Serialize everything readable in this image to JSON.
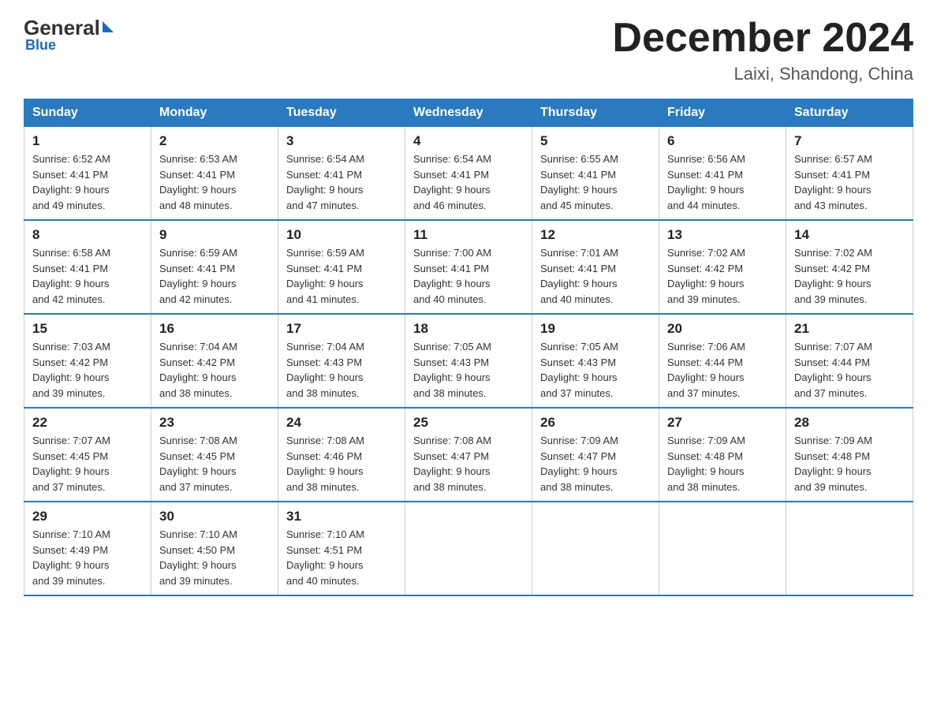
{
  "header": {
    "logo": {
      "general": "General",
      "blue": "Blue"
    },
    "title": "December 2024",
    "subtitle": "Laixi, Shandong, China"
  },
  "weekdays": [
    "Sunday",
    "Monday",
    "Tuesday",
    "Wednesday",
    "Thursday",
    "Friday",
    "Saturday"
  ],
  "weeks": [
    [
      {
        "day": "1",
        "sunrise": "Sunrise: 6:52 AM",
        "sunset": "Sunset: 4:41 PM",
        "daylight": "Daylight: 9 hours",
        "daylight2": "and 49 minutes."
      },
      {
        "day": "2",
        "sunrise": "Sunrise: 6:53 AM",
        "sunset": "Sunset: 4:41 PM",
        "daylight": "Daylight: 9 hours",
        "daylight2": "and 48 minutes."
      },
      {
        "day": "3",
        "sunrise": "Sunrise: 6:54 AM",
        "sunset": "Sunset: 4:41 PM",
        "daylight": "Daylight: 9 hours",
        "daylight2": "and 47 minutes."
      },
      {
        "day": "4",
        "sunrise": "Sunrise: 6:54 AM",
        "sunset": "Sunset: 4:41 PM",
        "daylight": "Daylight: 9 hours",
        "daylight2": "and 46 minutes."
      },
      {
        "day": "5",
        "sunrise": "Sunrise: 6:55 AM",
        "sunset": "Sunset: 4:41 PM",
        "daylight": "Daylight: 9 hours",
        "daylight2": "and 45 minutes."
      },
      {
        "day": "6",
        "sunrise": "Sunrise: 6:56 AM",
        "sunset": "Sunset: 4:41 PM",
        "daylight": "Daylight: 9 hours",
        "daylight2": "and 44 minutes."
      },
      {
        "day": "7",
        "sunrise": "Sunrise: 6:57 AM",
        "sunset": "Sunset: 4:41 PM",
        "daylight": "Daylight: 9 hours",
        "daylight2": "and 43 minutes."
      }
    ],
    [
      {
        "day": "8",
        "sunrise": "Sunrise: 6:58 AM",
        "sunset": "Sunset: 4:41 PM",
        "daylight": "Daylight: 9 hours",
        "daylight2": "and 42 minutes."
      },
      {
        "day": "9",
        "sunrise": "Sunrise: 6:59 AM",
        "sunset": "Sunset: 4:41 PM",
        "daylight": "Daylight: 9 hours",
        "daylight2": "and 42 minutes."
      },
      {
        "day": "10",
        "sunrise": "Sunrise: 6:59 AM",
        "sunset": "Sunset: 4:41 PM",
        "daylight": "Daylight: 9 hours",
        "daylight2": "and 41 minutes."
      },
      {
        "day": "11",
        "sunrise": "Sunrise: 7:00 AM",
        "sunset": "Sunset: 4:41 PM",
        "daylight": "Daylight: 9 hours",
        "daylight2": "and 40 minutes."
      },
      {
        "day": "12",
        "sunrise": "Sunrise: 7:01 AM",
        "sunset": "Sunset: 4:41 PM",
        "daylight": "Daylight: 9 hours",
        "daylight2": "and 40 minutes."
      },
      {
        "day": "13",
        "sunrise": "Sunrise: 7:02 AM",
        "sunset": "Sunset: 4:42 PM",
        "daylight": "Daylight: 9 hours",
        "daylight2": "and 39 minutes."
      },
      {
        "day": "14",
        "sunrise": "Sunrise: 7:02 AM",
        "sunset": "Sunset: 4:42 PM",
        "daylight": "Daylight: 9 hours",
        "daylight2": "and 39 minutes."
      }
    ],
    [
      {
        "day": "15",
        "sunrise": "Sunrise: 7:03 AM",
        "sunset": "Sunset: 4:42 PM",
        "daylight": "Daylight: 9 hours",
        "daylight2": "and 39 minutes."
      },
      {
        "day": "16",
        "sunrise": "Sunrise: 7:04 AM",
        "sunset": "Sunset: 4:42 PM",
        "daylight": "Daylight: 9 hours",
        "daylight2": "and 38 minutes."
      },
      {
        "day": "17",
        "sunrise": "Sunrise: 7:04 AM",
        "sunset": "Sunset: 4:43 PM",
        "daylight": "Daylight: 9 hours",
        "daylight2": "and 38 minutes."
      },
      {
        "day": "18",
        "sunrise": "Sunrise: 7:05 AM",
        "sunset": "Sunset: 4:43 PM",
        "daylight": "Daylight: 9 hours",
        "daylight2": "and 38 minutes."
      },
      {
        "day": "19",
        "sunrise": "Sunrise: 7:05 AM",
        "sunset": "Sunset: 4:43 PM",
        "daylight": "Daylight: 9 hours",
        "daylight2": "and 37 minutes."
      },
      {
        "day": "20",
        "sunrise": "Sunrise: 7:06 AM",
        "sunset": "Sunset: 4:44 PM",
        "daylight": "Daylight: 9 hours",
        "daylight2": "and 37 minutes."
      },
      {
        "day": "21",
        "sunrise": "Sunrise: 7:07 AM",
        "sunset": "Sunset: 4:44 PM",
        "daylight": "Daylight: 9 hours",
        "daylight2": "and 37 minutes."
      }
    ],
    [
      {
        "day": "22",
        "sunrise": "Sunrise: 7:07 AM",
        "sunset": "Sunset: 4:45 PM",
        "daylight": "Daylight: 9 hours",
        "daylight2": "and 37 minutes."
      },
      {
        "day": "23",
        "sunrise": "Sunrise: 7:08 AM",
        "sunset": "Sunset: 4:45 PM",
        "daylight": "Daylight: 9 hours",
        "daylight2": "and 37 minutes."
      },
      {
        "day": "24",
        "sunrise": "Sunrise: 7:08 AM",
        "sunset": "Sunset: 4:46 PM",
        "daylight": "Daylight: 9 hours",
        "daylight2": "and 38 minutes."
      },
      {
        "day": "25",
        "sunrise": "Sunrise: 7:08 AM",
        "sunset": "Sunset: 4:47 PM",
        "daylight": "Daylight: 9 hours",
        "daylight2": "and 38 minutes."
      },
      {
        "day": "26",
        "sunrise": "Sunrise: 7:09 AM",
        "sunset": "Sunset: 4:47 PM",
        "daylight": "Daylight: 9 hours",
        "daylight2": "and 38 minutes."
      },
      {
        "day": "27",
        "sunrise": "Sunrise: 7:09 AM",
        "sunset": "Sunset: 4:48 PM",
        "daylight": "Daylight: 9 hours",
        "daylight2": "and 38 minutes."
      },
      {
        "day": "28",
        "sunrise": "Sunrise: 7:09 AM",
        "sunset": "Sunset: 4:48 PM",
        "daylight": "Daylight: 9 hours",
        "daylight2": "and 39 minutes."
      }
    ],
    [
      {
        "day": "29",
        "sunrise": "Sunrise: 7:10 AM",
        "sunset": "Sunset: 4:49 PM",
        "daylight": "Daylight: 9 hours",
        "daylight2": "and 39 minutes."
      },
      {
        "day": "30",
        "sunrise": "Sunrise: 7:10 AM",
        "sunset": "Sunset: 4:50 PM",
        "daylight": "Daylight: 9 hours",
        "daylight2": "and 39 minutes."
      },
      {
        "day": "31",
        "sunrise": "Sunrise: 7:10 AM",
        "sunset": "Sunset: 4:51 PM",
        "daylight": "Daylight: 9 hours",
        "daylight2": "and 40 minutes."
      },
      null,
      null,
      null,
      null
    ]
  ]
}
